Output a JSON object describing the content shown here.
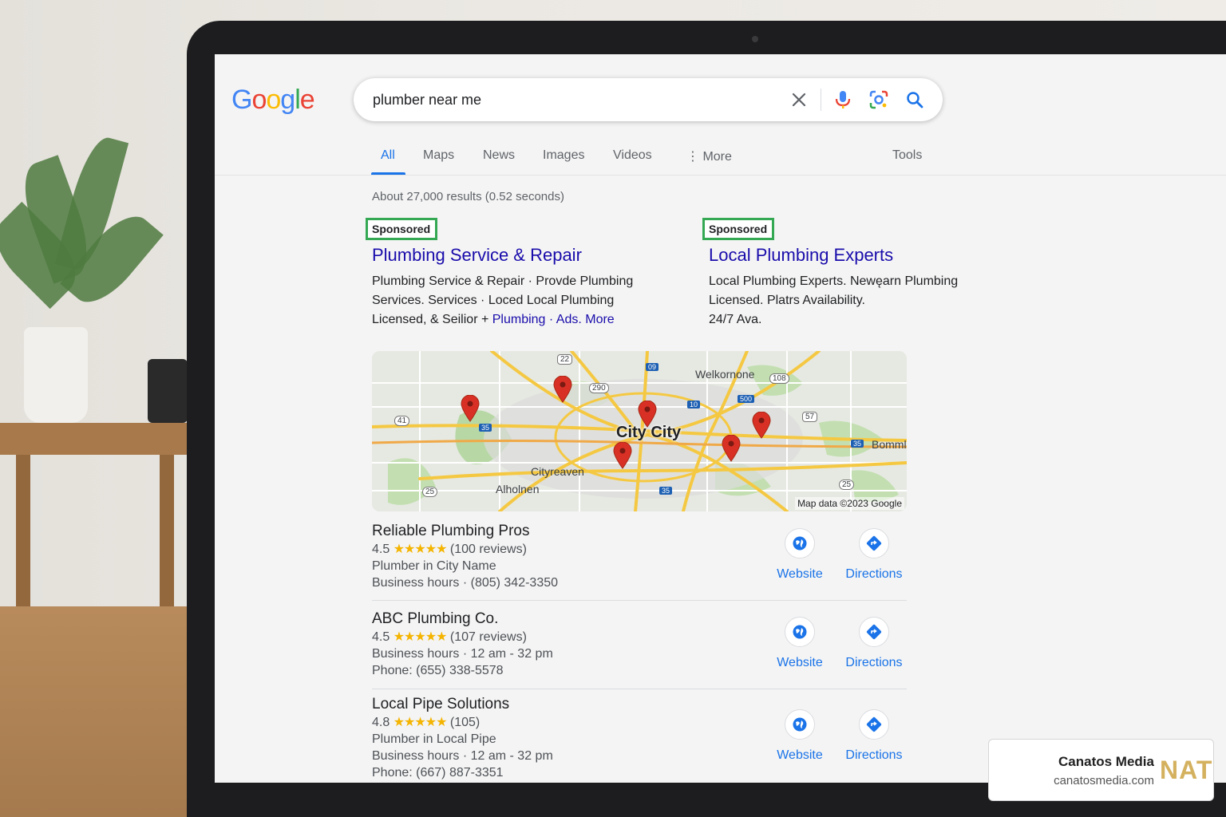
{
  "search": {
    "query": "plumber near me"
  },
  "google_logo": [
    "G",
    "o",
    "o",
    "g",
    "l",
    "e"
  ],
  "tabs": [
    {
      "label": "All",
      "active": true
    },
    {
      "label": "Maps"
    },
    {
      "label": "News"
    },
    {
      "label": "Images"
    },
    {
      "label": "Videos"
    },
    {
      "label": "⋮ More"
    },
    {
      "label": "Tools"
    }
  ],
  "result_stats": "About 27,000 results (0.52 seconds)",
  "ads": [
    {
      "badge": "Sponsored",
      "title": "Plumbing Service & Repair",
      "desc_line1": "Plumbing Service & Repair · Provde Plumbing",
      "desc_line2": "Services. Services · Loced Local Plumbing",
      "desc_line3_prefix": "Licensed, & Seilior + ",
      "desc_link1": "Plumbing",
      "desc_link2": " · Ads. More"
    },
    {
      "badge": "Sponsored",
      "title": "Local Plumbing Experts",
      "desc_line1": "Local Plumbing Experts. Newęarn Plumbing",
      "desc_line2": "Licensed. Platrs Availability.",
      "desc_line3": "24/7 Ava."
    }
  ],
  "map": {
    "city": "City City",
    "labels": {
      "welkornone": "Welkornone",
      "cityreaven": "Cityreaven",
      "alholnen": "Alholnen",
      "bomml": "Bomml"
    },
    "shields": [
      "22",
      "290",
      "09",
      "108",
      "10",
      "500",
      "57",
      "41",
      "35",
      "25",
      "35",
      "35",
      "25"
    ],
    "attribution": "Map data ©2023 Google"
  },
  "listings": [
    {
      "name": "Reliable Plumbing Pros",
      "rating": "4.5",
      "stars": "★★★★★",
      "reviews": "(100 reviews)",
      "line2": "Plumber in City Name",
      "line3": "Business hours · (805) 342-3350"
    },
    {
      "name": "ABC Plumbing Co.",
      "rating": "4.5",
      "stars": "★★★★★",
      "reviews": "(107 reviews)",
      "line2": "Business hours · 12 am - 32 pm",
      "line3": "Phone: (655) 338-5578"
    },
    {
      "name": "Local Pipe Solutions",
      "rating": "4.8",
      "stars": "★★★★★",
      "reviews": "(105)",
      "line2": "Plumber in Local Pipe",
      "line3": "Business hours · 12 am - 32 pm",
      "line4": "Phone: (667) 887-3351"
    }
  ],
  "actions": {
    "website": "Website",
    "directions": "Directions"
  },
  "brand": {
    "name": "Canatos Media",
    "url": "canatosmedia.com",
    "mark": "NATC"
  },
  "colors": {
    "google_blue": "#4285f4",
    "google_red": "#ea4335",
    "google_yellow": "#fbbc05",
    "google_green": "#34a853",
    "link_blue": "#1a0dab",
    "sponsored_border": "#34a853",
    "pin_red": "#d93025",
    "star_yellow": "#f4b400"
  }
}
